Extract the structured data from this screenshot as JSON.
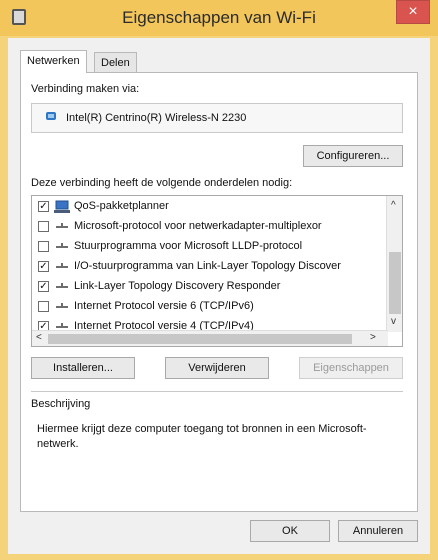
{
  "window": {
    "title": "Eigenschappen van Wi-Fi",
    "close": "×"
  },
  "tabs": [
    {
      "label": "Netwerken"
    },
    {
      "label": "Delen"
    }
  ],
  "connect_label": "Verbinding maken via:",
  "adapter_name": "Intel(R) Centrino(R) Wireless-N 2230",
  "configure_button": "Configureren...",
  "components_label": "Deze verbinding heeft de volgende onderdelen nodig:",
  "components": [
    {
      "label": "QoS-pakketplanner",
      "checked": "✓",
      "icon": "qos-icon"
    },
    {
      "label": "Microsoft-protocol voor netwerkadapter-multiplexor",
      "checked": "",
      "icon": "protocol-icon"
    },
    {
      "label": "Stuurprogramma voor Microsoft LLDP-protocol",
      "checked": "",
      "icon": "protocol-icon"
    },
    {
      "label": "I/O-stuurprogramma van Link-Layer Topology Discover",
      "checked": "✓",
      "icon": "protocol-icon"
    },
    {
      "label": "Link-Layer Topology Discovery Responder",
      "checked": "✓",
      "icon": "protocol-icon"
    },
    {
      "label": "Internet Protocol versie 6 (TCP/IPv6)",
      "checked": "",
      "icon": "protocol-icon"
    },
    {
      "label": "Internet Protocol versie 4 (TCP/IPv4)",
      "checked": "✓",
      "icon": "protocol-icon"
    }
  ],
  "scroll": {
    "up": "^",
    "down": "v",
    "left": "<",
    "right": ">"
  },
  "buttons": {
    "install": "Installeren...",
    "remove": "Verwijderen",
    "properties": "Eigenschappen",
    "ok": "OK",
    "cancel": "Annuleren"
  },
  "description": {
    "heading": "Beschrijving",
    "text": "Hiermee krijgt deze computer toegang tot bronnen in een Microsoft-netwerk."
  },
  "colors": {
    "title_bar": "#f2c65a",
    "window_frame": "#f5d37a",
    "close": "#d9534f",
    "accent": "#2e77c5"
  }
}
